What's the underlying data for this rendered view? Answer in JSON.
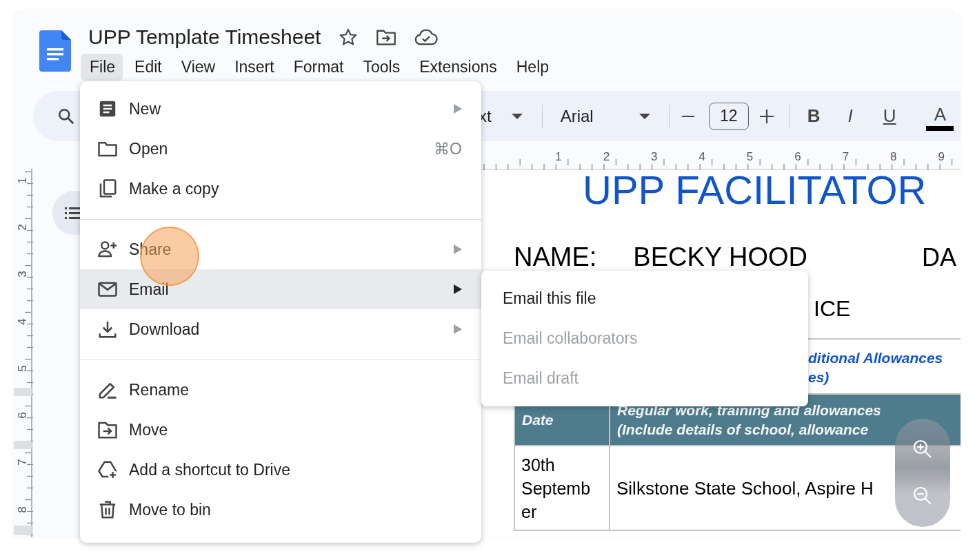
{
  "document": {
    "title": "UPP Template Timesheet"
  },
  "menubar": [
    {
      "label": "File",
      "selected": true
    },
    {
      "label": "Edit",
      "selected": false
    },
    {
      "label": "View",
      "selected": false
    },
    {
      "label": "Insert",
      "selected": false
    },
    {
      "label": "Format",
      "selected": false
    },
    {
      "label": "Tools",
      "selected": false
    },
    {
      "label": "Extensions",
      "selected": false
    },
    {
      "label": "Help",
      "selected": false
    }
  ],
  "toolbar": {
    "style_dropdown": "xt",
    "font_dropdown": "Arial",
    "font_size": "12",
    "format_buttons": [
      {
        "kind": "bold",
        "label": "B"
      },
      {
        "kind": "italic",
        "label": "I"
      },
      {
        "kind": "underline",
        "label": "U"
      },
      {
        "kind": "text_color",
        "label": "A"
      }
    ]
  },
  "ruler": {
    "horizontal": [
      "1",
      "2",
      "3",
      "4",
      "5",
      "6",
      "7",
      "8",
      "9"
    ],
    "vertical": [
      "1",
      "2",
      "3",
      "4",
      "5",
      "6",
      "7",
      "8"
    ]
  },
  "page": {
    "heading": "UPP FACILITATOR",
    "name_label": "NAME:",
    "name_value": "BECKY HOOD",
    "date_label": "DA",
    "line_fragment": "ICE",
    "note_lines": [
      "ditional Allowances",
      "es)"
    ],
    "table": {
      "columns": [
        "Date",
        "Regular work, training and allowances\n(Include details of school, allowance"
      ],
      "rows": [
        [
          "30th September",
          "Silkstone State School, Aspire H"
        ]
      ]
    }
  },
  "file_menu": [
    {
      "kind": "item",
      "label": "New",
      "submenu": true,
      "selected": false
    },
    {
      "kind": "item",
      "label": "Open",
      "shortcut": "⌘O",
      "submenu": false,
      "selected": false
    },
    {
      "kind": "item",
      "label": "Make a copy",
      "submenu": false,
      "selected": false
    },
    {
      "kind": "divider"
    },
    {
      "kind": "item",
      "label": "Share",
      "submenu": true,
      "selected": false
    },
    {
      "kind": "item",
      "label": "Email",
      "submenu": true,
      "selected": true
    },
    {
      "kind": "item",
      "label": "Download",
      "submenu": true,
      "selected": false
    },
    {
      "kind": "divider"
    },
    {
      "kind": "item",
      "label": "Rename",
      "submenu": false,
      "selected": false
    },
    {
      "kind": "item",
      "label": "Move",
      "submenu": false,
      "selected": false
    },
    {
      "kind": "item",
      "label": "Add a shortcut to Drive",
      "submenu": false,
      "selected": false
    },
    {
      "kind": "item",
      "label": "Move to bin",
      "submenu": false,
      "selected": false
    }
  ],
  "email_submenu": [
    {
      "label": "Email this file",
      "disabled": false
    },
    {
      "label": "Email collaborators",
      "disabled": true
    },
    {
      "label": "Email draft",
      "disabled": true
    }
  ]
}
